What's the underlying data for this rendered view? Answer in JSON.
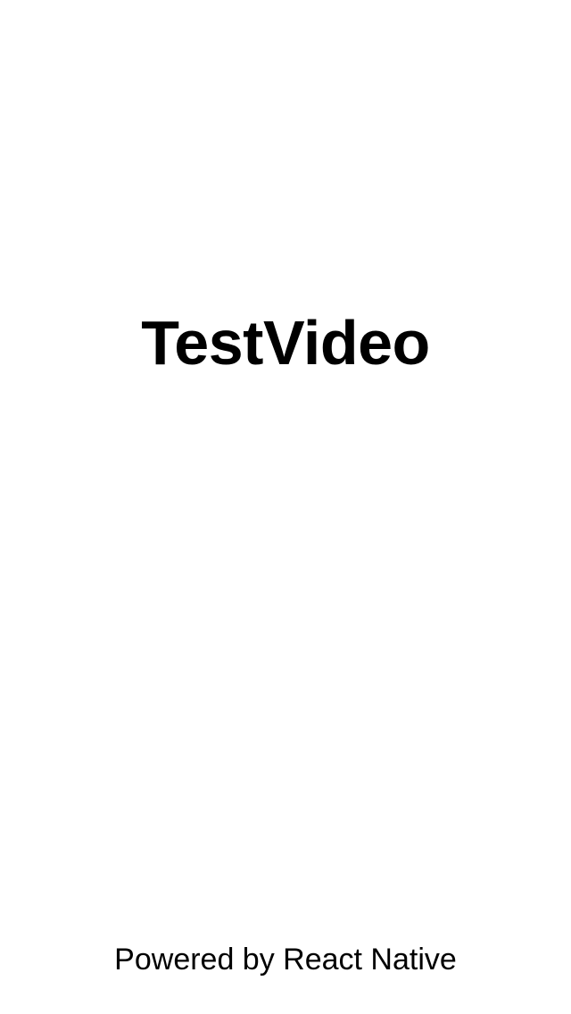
{
  "launch_screen": {
    "app_name": "TestVideo",
    "footer_text": "Powered by React Native"
  }
}
